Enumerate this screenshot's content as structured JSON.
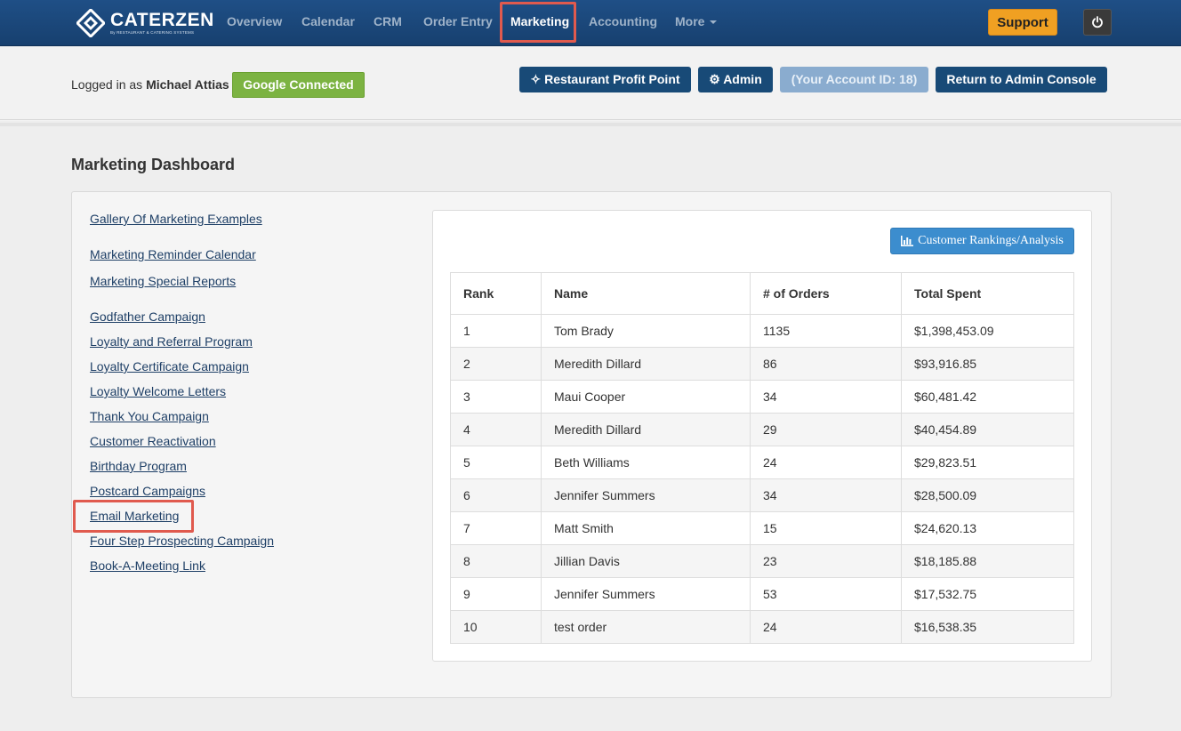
{
  "nav": {
    "logo_name": "CATERZEN",
    "logo_sub": "By RESTAURANT & CATERING SYSTEMS",
    "items": [
      "Overview",
      "Calendar",
      "CRM",
      "Order Entry",
      "Marketing",
      "Accounting",
      "More"
    ],
    "active": "Marketing",
    "support_label": "Support",
    "power_icon": "power-icon"
  },
  "header": {
    "logged_in_prefix": "Logged in as",
    "user_name": "Michael Attias",
    "google_label": "Google Connected",
    "profit_point_label": "Restaurant Profit Point",
    "admin_label": "Admin",
    "account_id_label": "(Your Account ID: 18)",
    "return_label": "Return to Admin Console"
  },
  "main": {
    "title": "Marketing Dashboard",
    "links": [
      "Gallery Of Marketing Examples",
      "Marketing Reminder Calendar",
      "Marketing Special Reports",
      "Godfather Campaign",
      "Loyalty and Referral Program",
      "Loyalty Certificate Campaign",
      "Loyalty Welcome Letters",
      "Thank You Campaign",
      "Customer Reactivation",
      "Birthday Program",
      "Postcard Campaigns",
      "Email Marketing",
      "Four Step Prospecting Campaign",
      "Book-A-Meeting Link"
    ],
    "rankings_button": "Customer Rankings/Analysis",
    "table": {
      "headers": [
        "Rank",
        "Name",
        "# of Orders",
        "Total Spent"
      ],
      "rows": [
        [
          "1",
          "Tom Brady",
          "1135",
          "$1,398,453.09"
        ],
        [
          "2",
          "Meredith Dillard",
          "86",
          "$93,916.85"
        ],
        [
          "3",
          "Maui Cooper",
          "34",
          "$60,481.42"
        ],
        [
          "4",
          "Meredith Dillard",
          "29",
          "$40,454.89"
        ],
        [
          "5",
          "Beth Williams",
          "24",
          "$29,823.51"
        ],
        [
          "6",
          "Jennifer Summers",
          "34",
          "$28,500.09"
        ],
        [
          "7",
          "Matt Smith",
          "15",
          "$24,620.13"
        ],
        [
          "8",
          "Jillian Davis",
          "23",
          "$18,185.88"
        ],
        [
          "9",
          "Jennifer Summers",
          "53",
          "$17,532.75"
        ],
        [
          "10",
          "test order",
          "24",
          "$16,538.35"
        ]
      ]
    }
  },
  "colors": {
    "nav_bg": "#1b4777",
    "highlight": "#e05a4e",
    "support": "#f0a022",
    "google": "#7cb342",
    "dark_button": "#184a77",
    "rank_button": "#3c8dce"
  }
}
